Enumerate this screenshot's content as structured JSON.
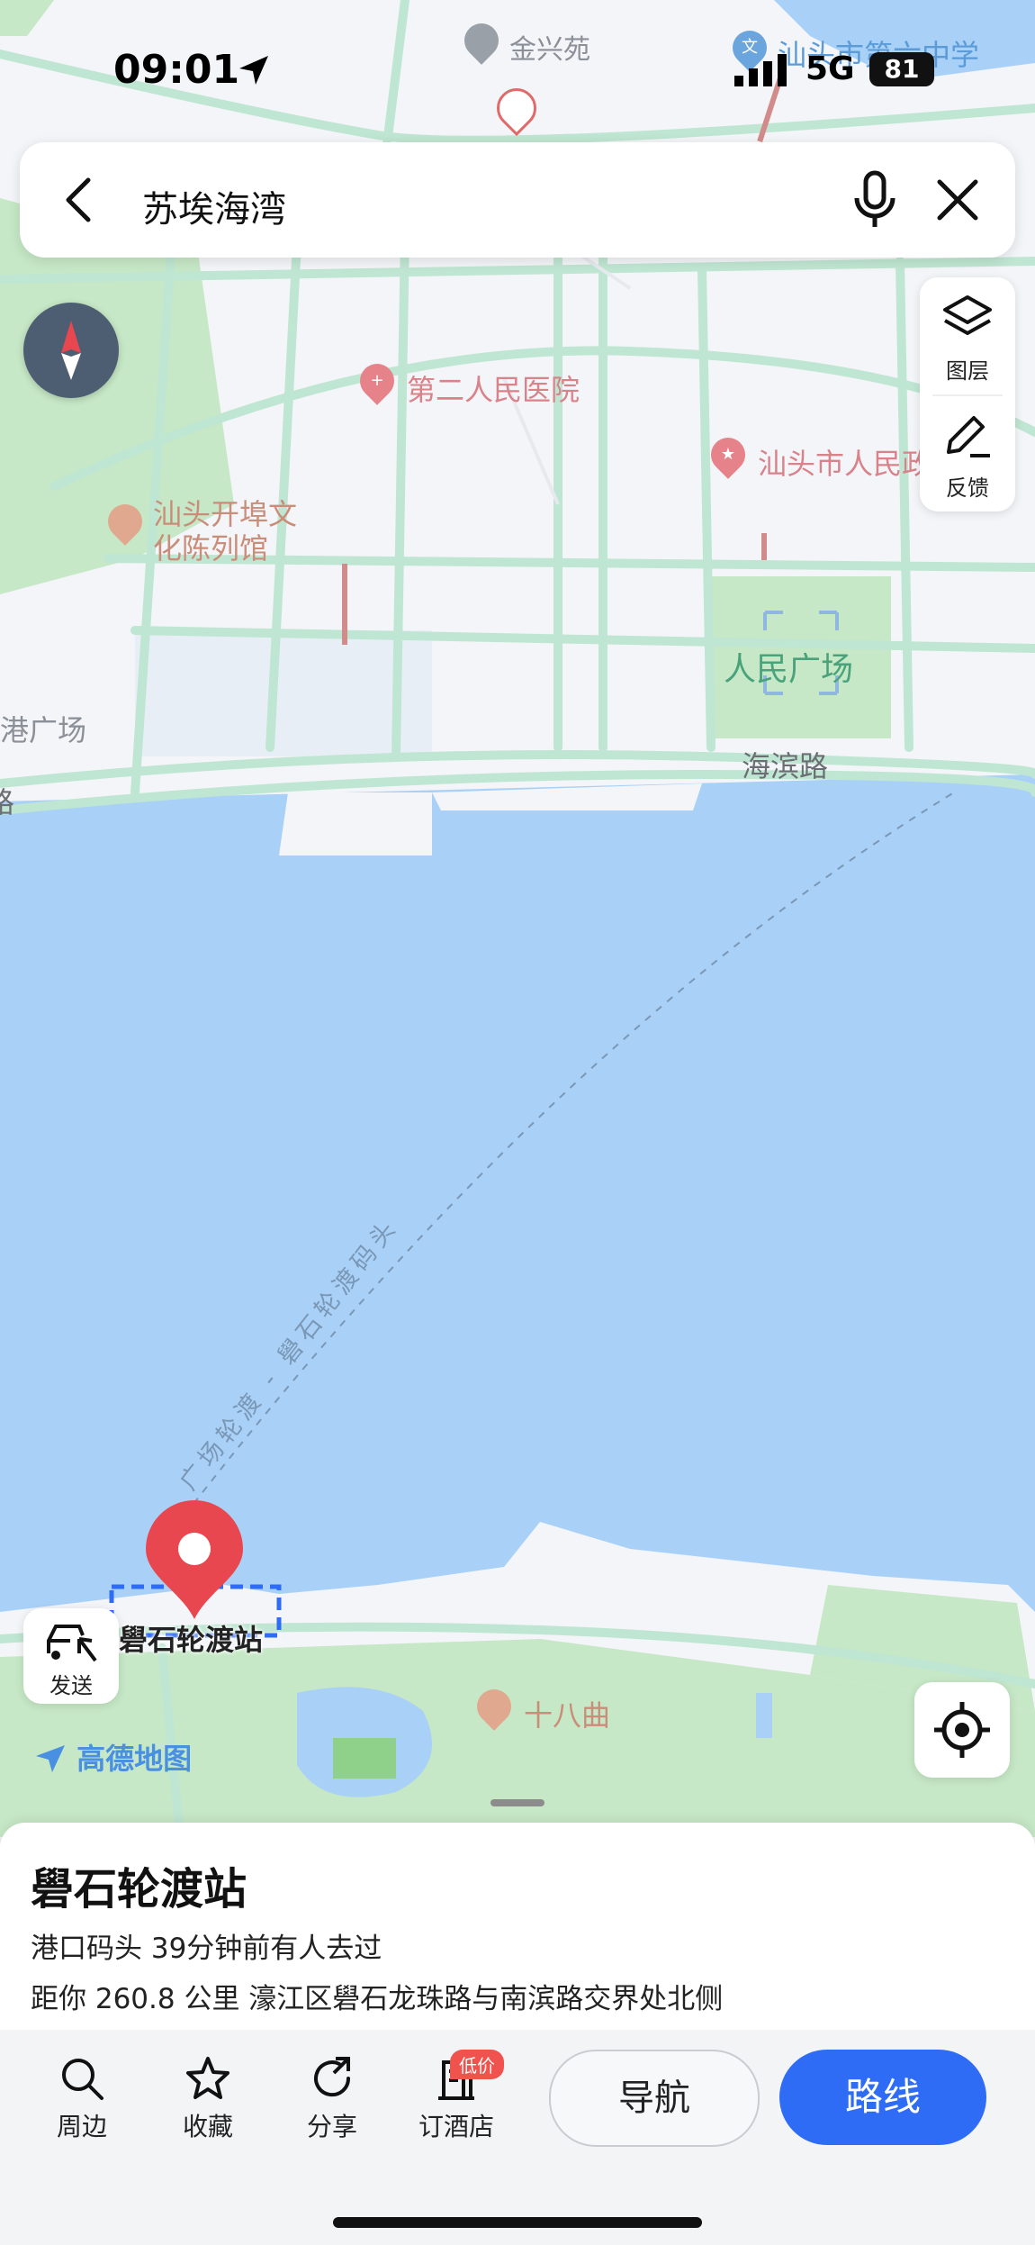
{
  "status_bar": {
    "time": "09:01",
    "network": "5G",
    "battery": "81"
  },
  "search": {
    "query": "苏埃海湾"
  },
  "map": {
    "pois": {
      "jinxingyuan": "金兴苑",
      "school": "汕头市第六中学",
      "hospital2": "第二人民医院",
      "govt": "汕头市人民政",
      "museum_l1": "汕头开埠文",
      "museum_l2": "化陈列馆",
      "square": "人民广场",
      "gangsquare": "港广场",
      "haibin_road": "海滨路",
      "road_edge": "路",
      "shibaqu": "十八曲"
    },
    "ferry_route": "广场轮渡 - 礐石轮渡码头",
    "destination_label": "礐石轮渡站",
    "brand": "高德地图"
  },
  "tools": {
    "layers": "图层",
    "feedback": "反馈",
    "send": "发送"
  },
  "place": {
    "name": "礐石轮渡站",
    "category_visited": "港口码头  39分钟前有人去过",
    "distance_address": "距你 260.8 公里  濠江区礐石龙珠路与南滨路交界处北侧"
  },
  "actions": {
    "nearby": "周边",
    "favorite": "收藏",
    "share": "分享",
    "hotel": "订酒店",
    "hotel_badge": "低价",
    "navigate": "导航",
    "route": "路线"
  },
  "colors": {
    "water": "#a9d1f7",
    "green": "#c6e8c6",
    "road": "#bfe6d2",
    "accent": "#2f6cf5",
    "pin": "#e8474f"
  }
}
